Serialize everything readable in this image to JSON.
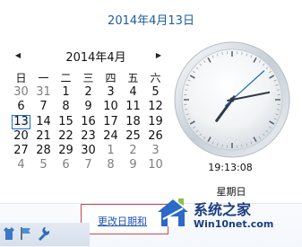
{
  "header": {
    "selected_date": "2014年4月13日"
  },
  "calendar": {
    "month_label": "2014年4月",
    "prev_icon": "triangle-left-icon",
    "next_icon": "triangle-right-icon",
    "weekdays": [
      "日",
      "一",
      "二",
      "三",
      "四",
      "五",
      "六"
    ],
    "weeks": [
      [
        "30",
        "31",
        "1",
        "2",
        "3",
        "4",
        "5"
      ],
      [
        "6",
        "7",
        "8",
        "9",
        "10",
        "11",
        "12"
      ],
      [
        "13",
        "14",
        "15",
        "16",
        "17",
        "18",
        "19"
      ],
      [
        "20",
        "21",
        "22",
        "23",
        "24",
        "25",
        "26"
      ],
      [
        "27",
        "28",
        "29",
        "30",
        "1",
        "2",
        "3"
      ],
      [
        "4",
        "5",
        "6",
        "7",
        "8",
        "9",
        "10"
      ]
    ],
    "today_value": "13",
    "other_month_positions": [
      [
        0,
        0
      ],
      [
        0,
        1
      ],
      [
        4,
        4
      ],
      [
        4,
        5
      ],
      [
        4,
        6
      ],
      [
        5,
        0
      ],
      [
        5,
        1
      ],
      [
        5,
        2
      ],
      [
        5,
        3
      ],
      [
        5,
        4
      ],
      [
        5,
        5
      ],
      [
        5,
        6
      ]
    ]
  },
  "clock": {
    "time_text": "19:13:08",
    "weekday_text": "星期日"
  },
  "footer": {
    "change_link_text": "更改日期和"
  },
  "tray": {
    "icons": [
      "shirt-icon",
      "flag-icon",
      "wrench-icon"
    ]
  },
  "watermark": {
    "title": "系统之家",
    "subtitle": "Win10net.com"
  },
  "colors": {
    "header_blue": "#1f5d99",
    "selection_blue": "#1f6fd1",
    "link_blue": "#1f4fb5",
    "link_box_red": "#c94b4b",
    "watermark_blue": "#1a3d7e"
  }
}
